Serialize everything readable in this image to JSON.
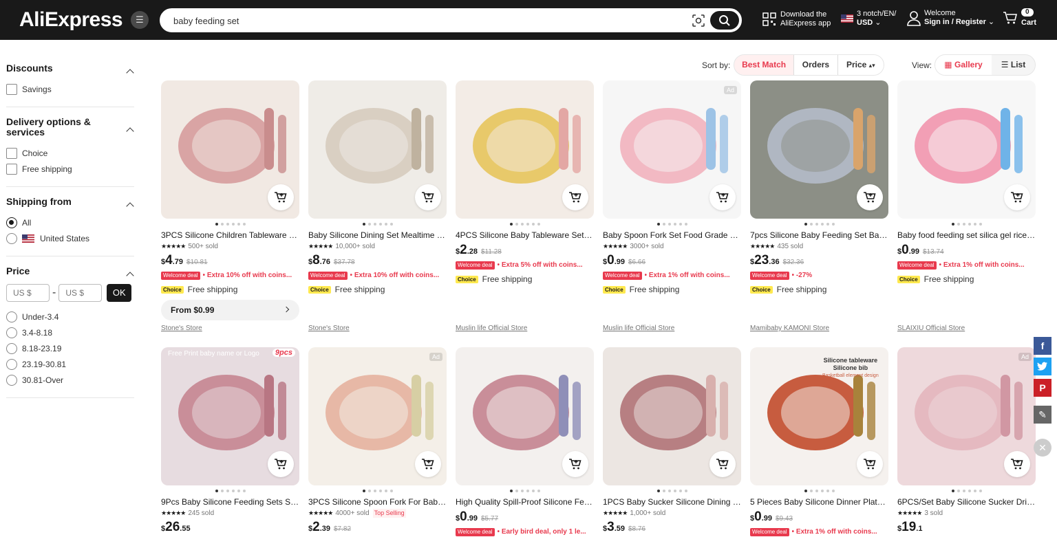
{
  "header": {
    "logo": "AliExpress",
    "search_value": "baby feeding set",
    "download_line1": "Download the",
    "download_line2": "AliExpress app",
    "locale_line1": "3 notch/EN/",
    "locale_line2": "USD",
    "welcome": "Welcome",
    "signin": "Sign in / Register",
    "cart_count": "0",
    "cart_label": "Cart"
  },
  "sidebar": {
    "discounts": {
      "title": "Discounts",
      "options": [
        "Savings"
      ]
    },
    "delivery": {
      "title": "Delivery options & services",
      "options": [
        "Choice",
        "Free shipping"
      ]
    },
    "shipping_from": {
      "title": "Shipping from",
      "options": [
        "All",
        "United States"
      ],
      "selected": "All"
    },
    "price": {
      "title": "Price",
      "min_placeholder": "US $",
      "max_placeholder": "US $",
      "sep": "-",
      "ok": "OK",
      "ranges": [
        "Under-3.4",
        "3.4-8.18",
        "8.18-23.19",
        "23.19-30.81",
        "30.81-Over"
      ]
    }
  },
  "sortbar": {
    "label": "Sort by:",
    "options": [
      "Best Match",
      "Orders",
      "Price"
    ],
    "active": "Best Match",
    "view_label": "View:",
    "views": [
      "Gallery",
      "List"
    ],
    "active_view": "Gallery"
  },
  "products": [
    {
      "title": "3PCS Silicone Children Tableware B...",
      "sold": "500+ sold",
      "cur": "$",
      "int": "4",
      "dec": ".79",
      "orig": "$10.81",
      "deal": "• Extra 10% off with coins...",
      "ship": "Free shipping",
      "from": "From $0.99",
      "store": "Stone's Store",
      "ad": false
    },
    {
      "title": "Baby Silicone Dining Set Mealtime F...",
      "sold": "10,000+ sold",
      "cur": "$",
      "int": "8",
      "dec": ".76",
      "orig": "$37.78",
      "deal": "• Extra 10% off with coins...",
      "ship": "Free shipping",
      "store": "Stone's Store",
      "ad": false
    },
    {
      "title": "4PCS Silicone Baby Tableware Set Li...",
      "sold": "",
      "cur": "$",
      "int": "2",
      "dec": ".28",
      "orig": "$11.28",
      "deal": "• Extra 5% off with coins...",
      "ship": "Free shipping",
      "store": "Muslin life Official Store",
      "ad": false
    },
    {
      "title": "Baby Spoon Fork Set Food Grade Sil...",
      "sold": "3000+ sold",
      "cur": "$",
      "int": "0",
      "dec": ".99",
      "orig": "$6.66",
      "deal": "• Extra 1% off with coins...",
      "ship": "Free shipping",
      "store": "Muslin life Official Store",
      "ad": true
    },
    {
      "title": "7pcs Silicone Baby Feeding Set Bab...",
      "sold": "435 sold",
      "cur": "$",
      "int": "23",
      "dec": ".36",
      "orig": "$32.36",
      "deal": "• -27%",
      "ship": "Free shipping",
      "store": "Mamibaby KAMONI Store",
      "ad": false
    },
    {
      "title": "Baby food feeding set silica gel rice ...",
      "sold": "",
      "cur": "$",
      "int": "0",
      "dec": ".99",
      "orig": "$13.74",
      "deal": "• Extra 1% off with coins...",
      "ship": "Free shipping",
      "store": "SLAIXIU Official Store",
      "ad": false
    },
    {
      "title": "9Pcs Baby Silicone Feeding Sets Suc...",
      "sold": "245 sold",
      "cur": "$",
      "int": "26",
      "dec": ".55",
      "orig": "",
      "deal": "",
      "thumb_text1": "Free Print baby name or Logo",
      "thumb_text2": "9pcs",
      "ad": false
    },
    {
      "title": "3PCS Silicone Spoon Fork For Baby ...",
      "sold": "4000+ sold",
      "top": "Top Selling",
      "cur": "$",
      "int": "2",
      "dec": ".39",
      "orig": "$7.82",
      "deal": "",
      "ad": true
    },
    {
      "title": "High Quality Spill-Proof Silicone Fee...",
      "sold": "",
      "cur": "$",
      "int": "0",
      "dec": ".99",
      "orig": "$5.77",
      "deal": "• Early bird deal, only 1 le...",
      "ad": false
    },
    {
      "title": "1PCS Baby Sucker Silicone Dining Pl...",
      "sold": "1,000+ sold",
      "cur": "$",
      "int": "3",
      "dec": ".59",
      "orig": "$8.76",
      "deal": "",
      "ad": false
    },
    {
      "title": "5 Pieces Baby Silicone Dinner Plate ...",
      "sold": "",
      "cur": "$",
      "int": "0",
      "dec": ".99",
      "orig": "$9.43",
      "deal": "• Extra 1% off with coins...",
      "thumb_text1": "Silicone tableware",
      "thumb_text2": "Silicone bib",
      "thumb_text3": "Basketball element design",
      "ad": false
    },
    {
      "title": "6PCS/Set Baby Silicone Sucker Drin...",
      "sold": "3 sold",
      "cur": "$",
      "int": "19",
      "dec": ".1",
      "orig": "",
      "deal": "",
      "ad": true
    }
  ],
  "badges": {
    "welcome_deal": "Welcome deal",
    "choice": "Choice",
    "ad": "Ad"
  },
  "colors": {
    "brand_red": "#e8394d",
    "header_bg": "#191919",
    "choice_yellow": "#ffe94f"
  },
  "social": [
    "f",
    "twitter-icon",
    "P",
    "edit-icon"
  ]
}
